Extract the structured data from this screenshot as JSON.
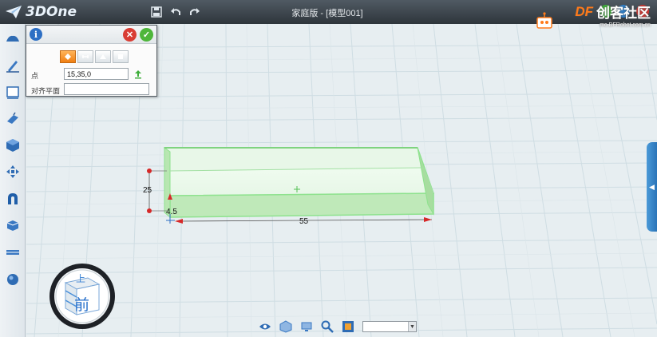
{
  "app": {
    "name": "3DOne",
    "window_title": "家庭版 - [模型001]"
  },
  "watermark": {
    "brand": "DF",
    "text": "创客社区",
    "url": "mc.DFRobot.com.cn"
  },
  "quick_access": {
    "icons": [
      "save-icon",
      "undo-icon",
      "redo-icon"
    ]
  },
  "left_toolbar": {
    "tools": [
      "basic-shapes-icon",
      "sketch-icon",
      "sketch-edit-icon",
      "feature-modeling-icon",
      "special-function-icon",
      "basic-edit-icon",
      "combine-icon",
      "automatic-icon",
      "measure-icon",
      "material-icon"
    ]
  },
  "properties_panel": {
    "point_label": "点",
    "point_value": "15,35,0",
    "align_plane_label": "对齐平面",
    "align_plane_value": "",
    "mode_buttons": [
      "box-mode-active",
      "mode-2",
      "mode-3",
      "mode-4"
    ]
  },
  "dimensions": {
    "height": "25",
    "width": "55",
    "depth": "4.5"
  },
  "view_cube": {
    "top_label": "上",
    "front_label": "前"
  },
  "bottom_toolbar": {
    "icons": [
      "view-icon",
      "render-mode-icon",
      "display-icon",
      "zoom-icon",
      "snap-icon"
    ],
    "select_value": ""
  },
  "colors": {
    "titlebar": "#2e353b",
    "accent_blue": "#2a74b8",
    "box_green": "#8ee28e",
    "active_orange": "#f07f12"
  }
}
